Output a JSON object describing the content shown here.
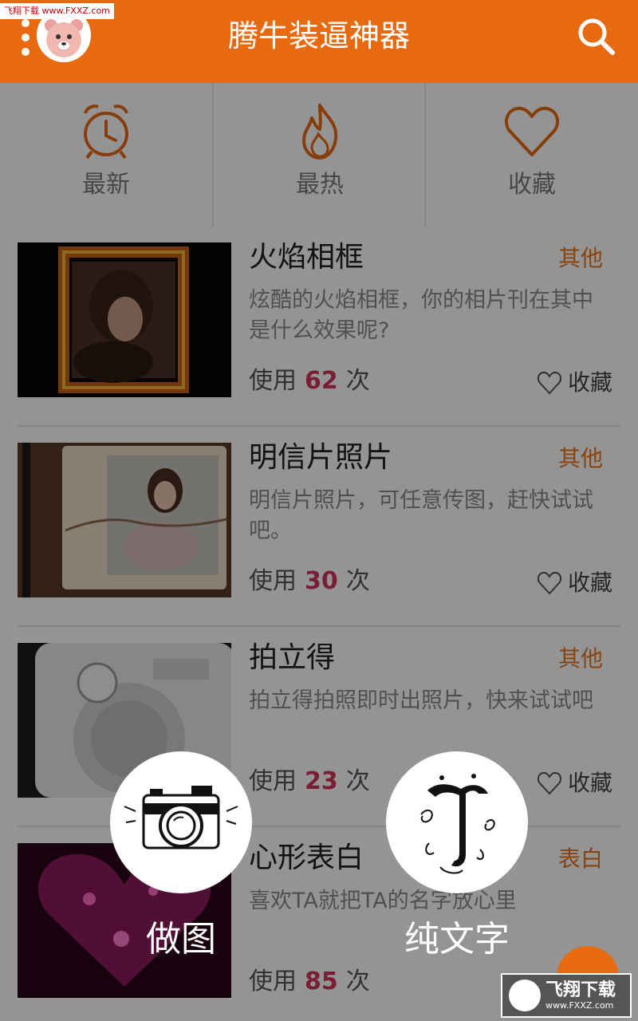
{
  "watermark_top": "飞翔下载 www.FXXZ.com",
  "header": {
    "title": "腾牛装逼神器"
  },
  "icons": {
    "menu": "more-vert-icon",
    "avatar": "bear-avatar",
    "search": "search-icon"
  },
  "tabs": [
    {
      "label": "最新",
      "icon": "alarm-clock-icon"
    },
    {
      "label": "最热",
      "icon": "flame-icon"
    },
    {
      "label": "收藏",
      "icon": "heart-icon"
    }
  ],
  "items": [
    {
      "title": "火焰相框",
      "category": "其他",
      "description": "炫酷的火焰相框，你的相片刊在其中是什么效果呢?",
      "usage_prefix": "使用",
      "count": "62",
      "usage_suffix": "次",
      "fav_label": "收藏"
    },
    {
      "title": "明信片照片",
      "category": "其他",
      "description": "明信片照片，可任意传图，赶快试试吧。",
      "usage_prefix": "使用",
      "count": "30",
      "usage_suffix": "次",
      "fav_label": "收藏"
    },
    {
      "title": "拍立得",
      "category": "其他",
      "description": "拍立得拍照即时出照片，快来试试吧",
      "usage_prefix": "使用",
      "count": "23",
      "usage_suffix": "次",
      "fav_label": "收藏"
    },
    {
      "title": "心形表白",
      "category": "表白",
      "description": "喜欢TA就把TA的名字放心里",
      "usage_prefix": "使用",
      "count": "85",
      "usage_suffix": "次",
      "fav_label": "收藏"
    }
  ],
  "fab_menu": {
    "make_image_label": "做图",
    "plain_text_label": "纯文字"
  },
  "watermark_bottom": {
    "brand": "飞翔下载",
    "url": "www.FXXZ.com"
  },
  "colors": {
    "primary": "#e86a10",
    "count": "#d2335e",
    "category": "#e8761e"
  }
}
